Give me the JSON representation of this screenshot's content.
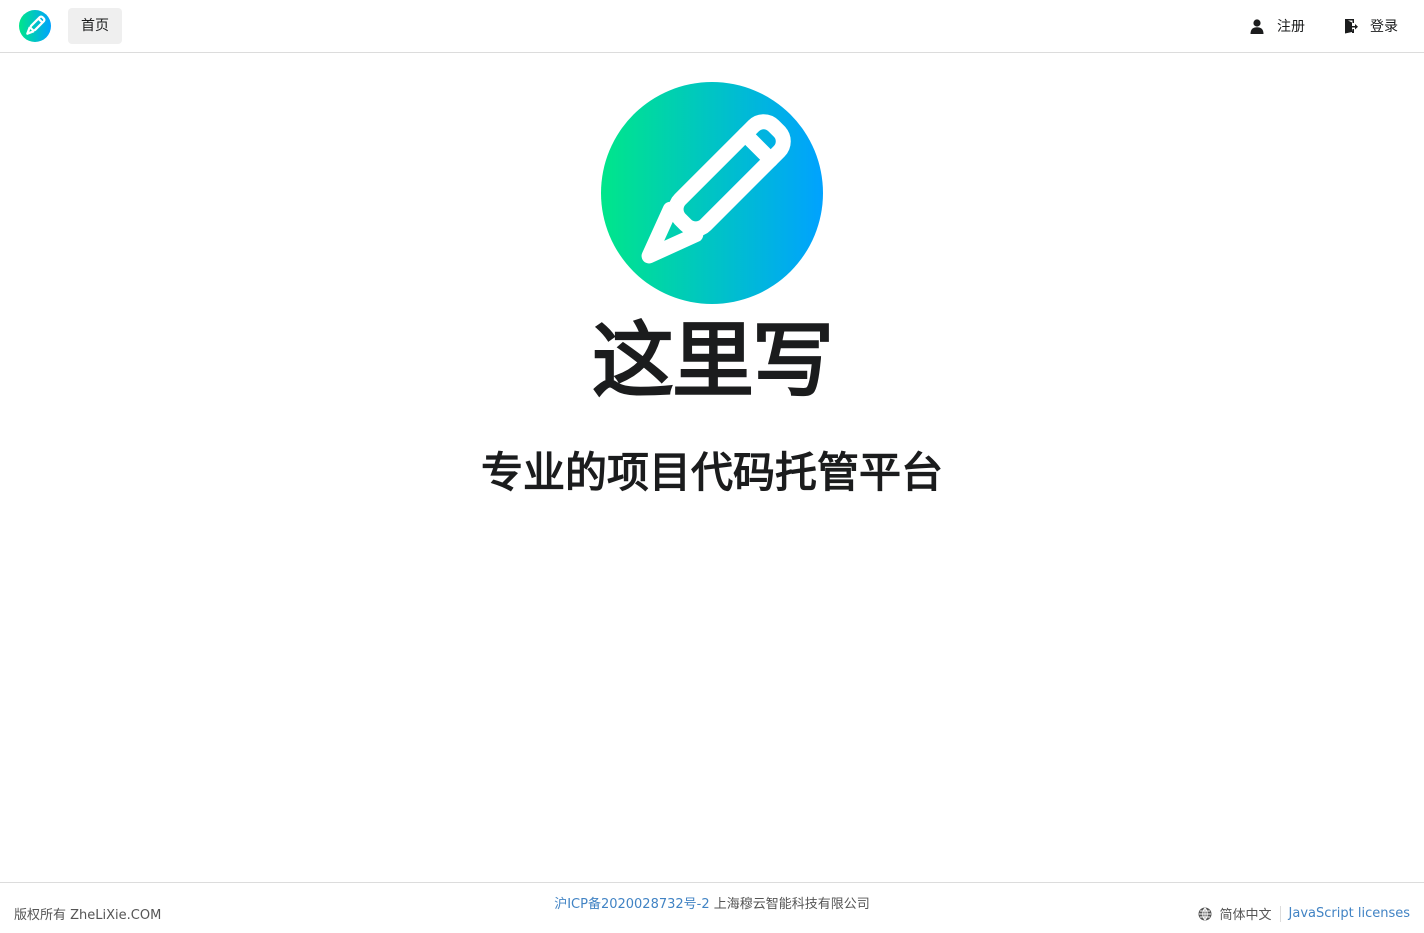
{
  "navbar": {
    "logo_icon": "pencil-logo-icon",
    "home_label": "首页",
    "register_label": "注册",
    "register_icon": "user-icon",
    "login_label": "登录",
    "login_icon": "sign-in-icon"
  },
  "hero": {
    "logo_icon": "pencil-logo-icon",
    "title": "这里写",
    "subtitle": "专业的项目代码托管平台"
  },
  "footer": {
    "copyright": "版权所有 ZheLiXie.COM",
    "icp_link": "沪ICP备2020028732号-2",
    "company": "上海穆云智能科技有限公司",
    "language_icon": "globe-icon",
    "language_label": "简体中文",
    "js_licenses_label": "JavaScript licenses"
  },
  "colors": {
    "gradient_start": "#00e68a",
    "gradient_end": "#00a2ff",
    "link": "#4183c4",
    "text": "#1b1c1d"
  }
}
